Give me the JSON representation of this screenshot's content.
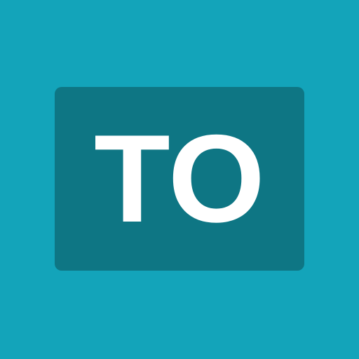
{
  "icon": {
    "text": "TO",
    "background_color": "#13a4ba",
    "badge_color": "#0e7684",
    "text_color": "#ffffff"
  }
}
